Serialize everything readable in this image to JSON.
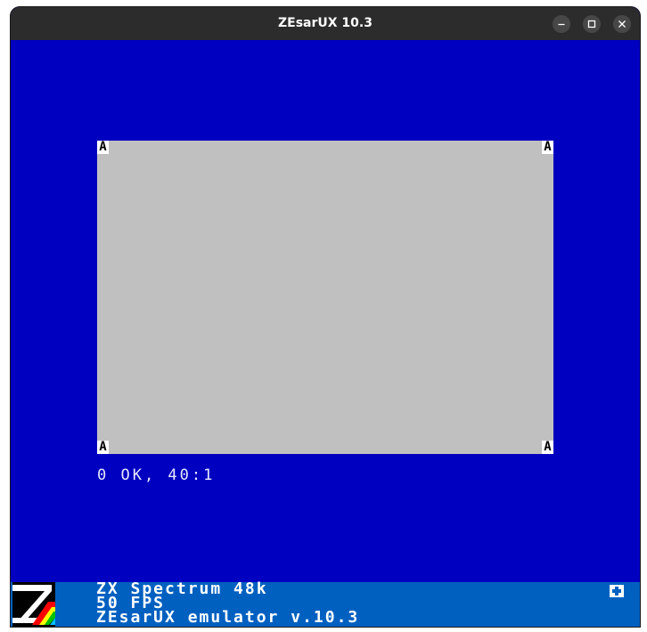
{
  "window": {
    "title": "ZEsarUX 10.3",
    "controls": {
      "minimize": "–",
      "maximize": "□",
      "close": "✕"
    }
  },
  "screen": {
    "corner_char": "A",
    "border_color": "#0000c0",
    "paper_color": "#c0c0c0"
  },
  "status": {
    "text": "0 OK, 40:1"
  },
  "footer": {
    "line1": "ZX Spectrum 48k",
    "line2": "50 FPS",
    "line3": "ZEsarUX emulator v.10.3",
    "icon": "plus-square-icon"
  }
}
